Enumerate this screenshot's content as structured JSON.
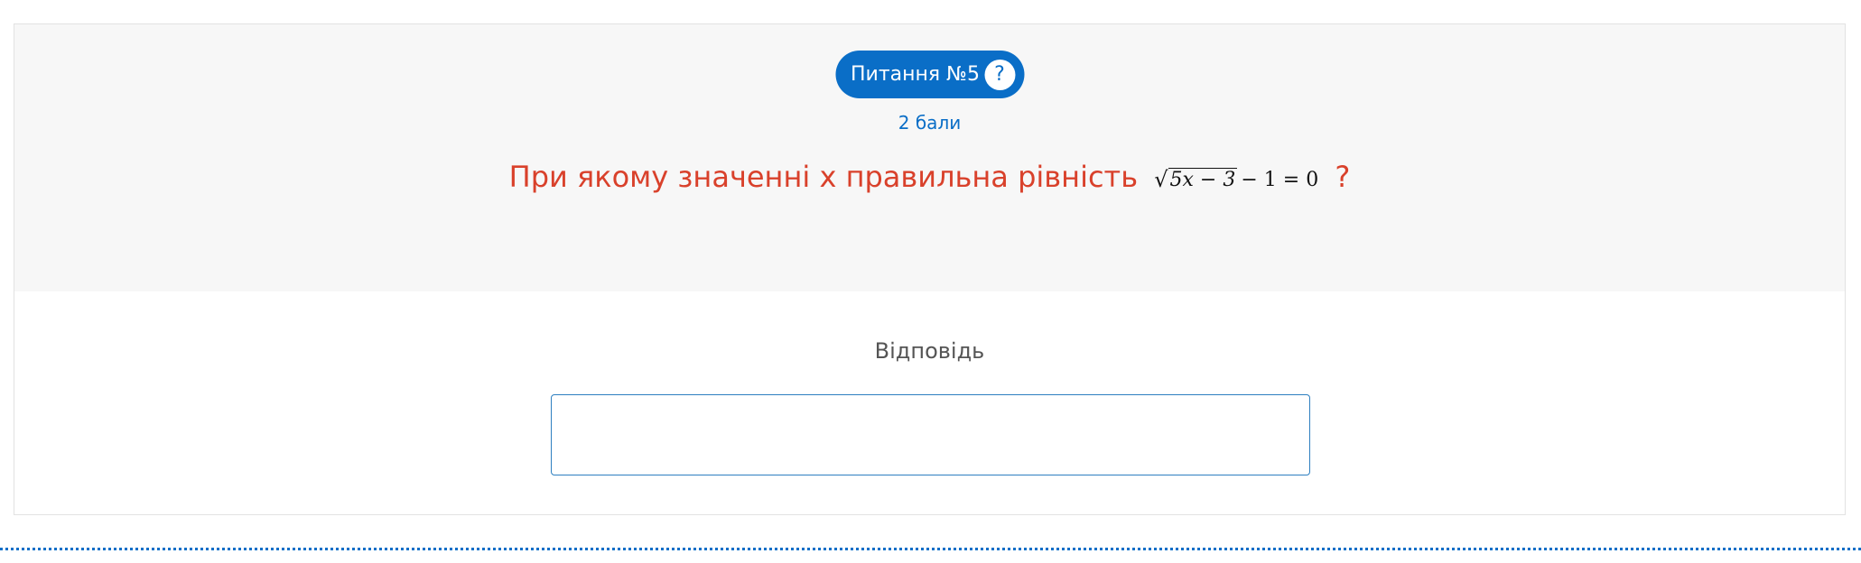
{
  "question": {
    "badge_label": "Питання №5",
    "help_symbol": "?",
    "points": "2 бали",
    "text_before": "При якому значенні x правильна рівність",
    "formula": {
      "sqrt_sign": "√",
      "radicand": "5x − 3",
      "rest": "− 1 = 0"
    },
    "text_after": "?"
  },
  "answer": {
    "label": "Відповідь",
    "value": ""
  },
  "colors": {
    "accent": "#0a6ec7",
    "question_text": "#d9412b",
    "question_bg": "#f7f7f7"
  },
  "icons": {
    "help": "question-mark-icon"
  }
}
